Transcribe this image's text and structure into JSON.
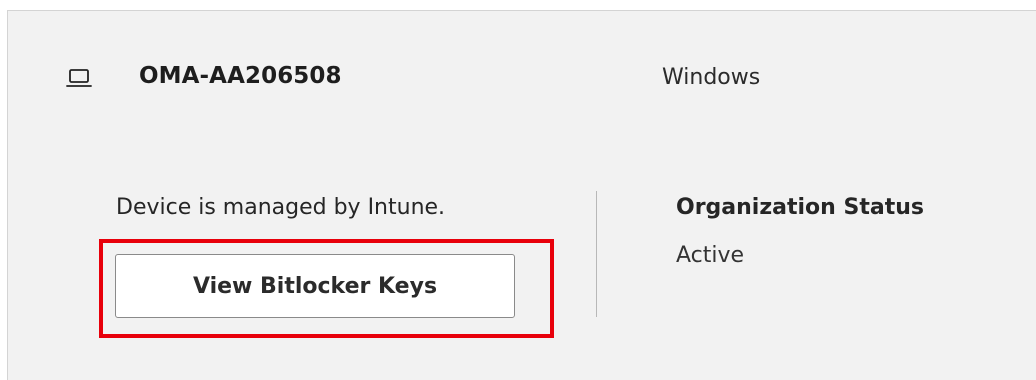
{
  "device": {
    "icon": "laptop-icon",
    "name": "OMA-AA206508",
    "os": "Windows"
  },
  "management": {
    "text": "Device is managed by Intune.",
    "button_label": "View Bitlocker Keys"
  },
  "organization": {
    "heading": "Organization Status",
    "value": "Active"
  },
  "colors": {
    "card_background": "#f2f2f2",
    "highlight_border": "#e8000b",
    "button_background": "#ffffff"
  }
}
